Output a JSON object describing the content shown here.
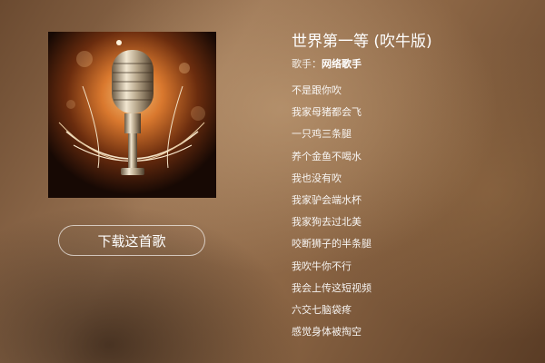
{
  "song": {
    "title": "世界第一等 (吹牛版)",
    "singer_label": "歌手：",
    "singer_name": "网络歌手"
  },
  "actions": {
    "download_label": "下载这首歌"
  },
  "lyrics": [
    "不是跟你吹",
    "我家母猪都会飞",
    "一只鸡三条腿",
    "养个金鱼不喝水",
    "我也没有吹",
    "我家驴会端水杯",
    "我家狗去过北美",
    "咬断狮子的半条腿",
    "我吹牛你不行",
    "我会上传这短视频",
    "六交七脑袋疼",
    "感觉身体被掏空"
  ],
  "cover": {
    "icon": "microphone-icon",
    "colors": {
      "glow": "#e08a3c",
      "background": "#1a0d06",
      "chrome": "#d9d2c4"
    }
  }
}
